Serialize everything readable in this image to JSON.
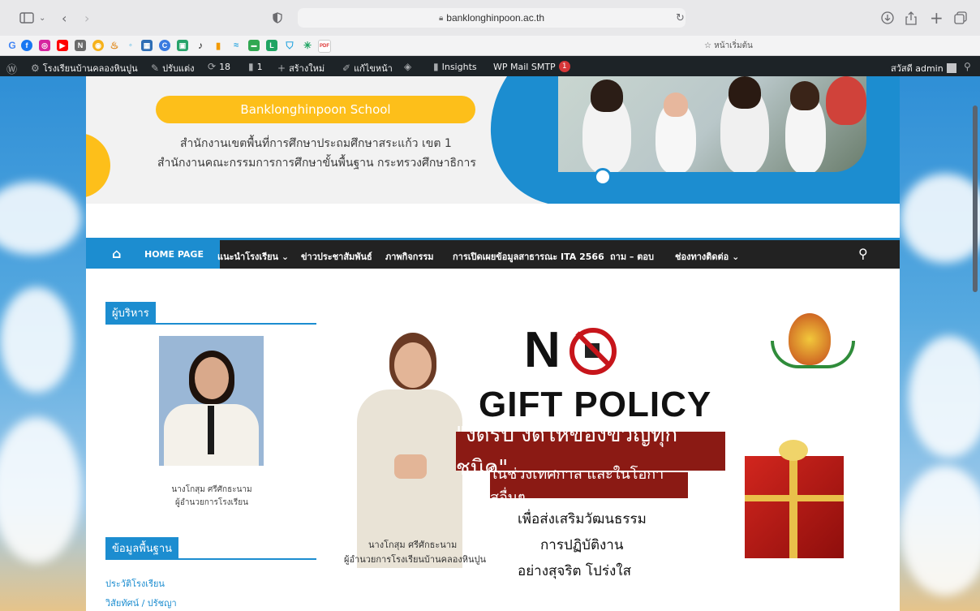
{
  "browser": {
    "url": "banklonghinpoon.ac.th",
    "favorites_label": "☆ หน้าเริ่มต้น"
  },
  "adminbar": {
    "site_name": "โรงเรียนบ้านคลองหินปูน",
    "customize": "ปรับแต่ง",
    "updates": "18",
    "comments": "1",
    "new": "สร้างใหม่",
    "edit": "แก้ไขหน้า",
    "insights": "Insights",
    "wpmail": "WP Mail SMTP",
    "wpmail_badge": "1",
    "greeting": "สวัสดี admin"
  },
  "header": {
    "school_en": "Banklonghinpoon School",
    "office_line1": "สำนักงานเขตพื้นที่การศึกษาประถมศึกษาสระแก้ว เขต 1",
    "office_line2": "สำนักงานคณะกรรมการการศึกษาขั้นพื้นฐาน กระทรวงศึกษาธิการ"
  },
  "nav": {
    "items": [
      {
        "label": "HOME PAGE"
      },
      {
        "label": "แนะนำโรงเรียน ⌄"
      },
      {
        "label": "ข่าวประชาสัมพันธ์"
      },
      {
        "label": "ภาพกิจกรรม"
      },
      {
        "label": "การเปิดเผยข้อมูลสาธารณะ ITA 2566"
      },
      {
        "label": "ถาม – ตอบ"
      },
      {
        "label": "ช่องทางติดต่อ ⌄"
      }
    ]
  },
  "sidebar": {
    "admin_title": "ผู้บริหาร",
    "director_name": "นางโกสุม ศรีศักธะนาม",
    "director_role": "ผู้อำนวยการโรงเรียน",
    "info_title": "ข้อมูลพื้นฐาน",
    "links": [
      "ประวัติโรงเรียน",
      "วิสัยทัศน์ / ปรัชญา"
    ]
  },
  "banner": {
    "no": "N",
    "gift_policy": "GIFT POLICY",
    "slogan1": "\"งดรับ งดให้ของขวัญทุกชนิด\"",
    "slogan2": "ในช่วงเทศกาล และในโอกาสอื่นๆ",
    "line1": "เพื่อส่งเสริมวัฒนธรรม",
    "line2": "การปฏิบัติงาน",
    "line3": "อย่างสุจริต โปร่งใส",
    "caption_name": "นางโกสุม  ศรีศักธะนาม",
    "caption_role": "ผู้อำนวยการโรงเรียนบ้านคลองหินปูน"
  }
}
